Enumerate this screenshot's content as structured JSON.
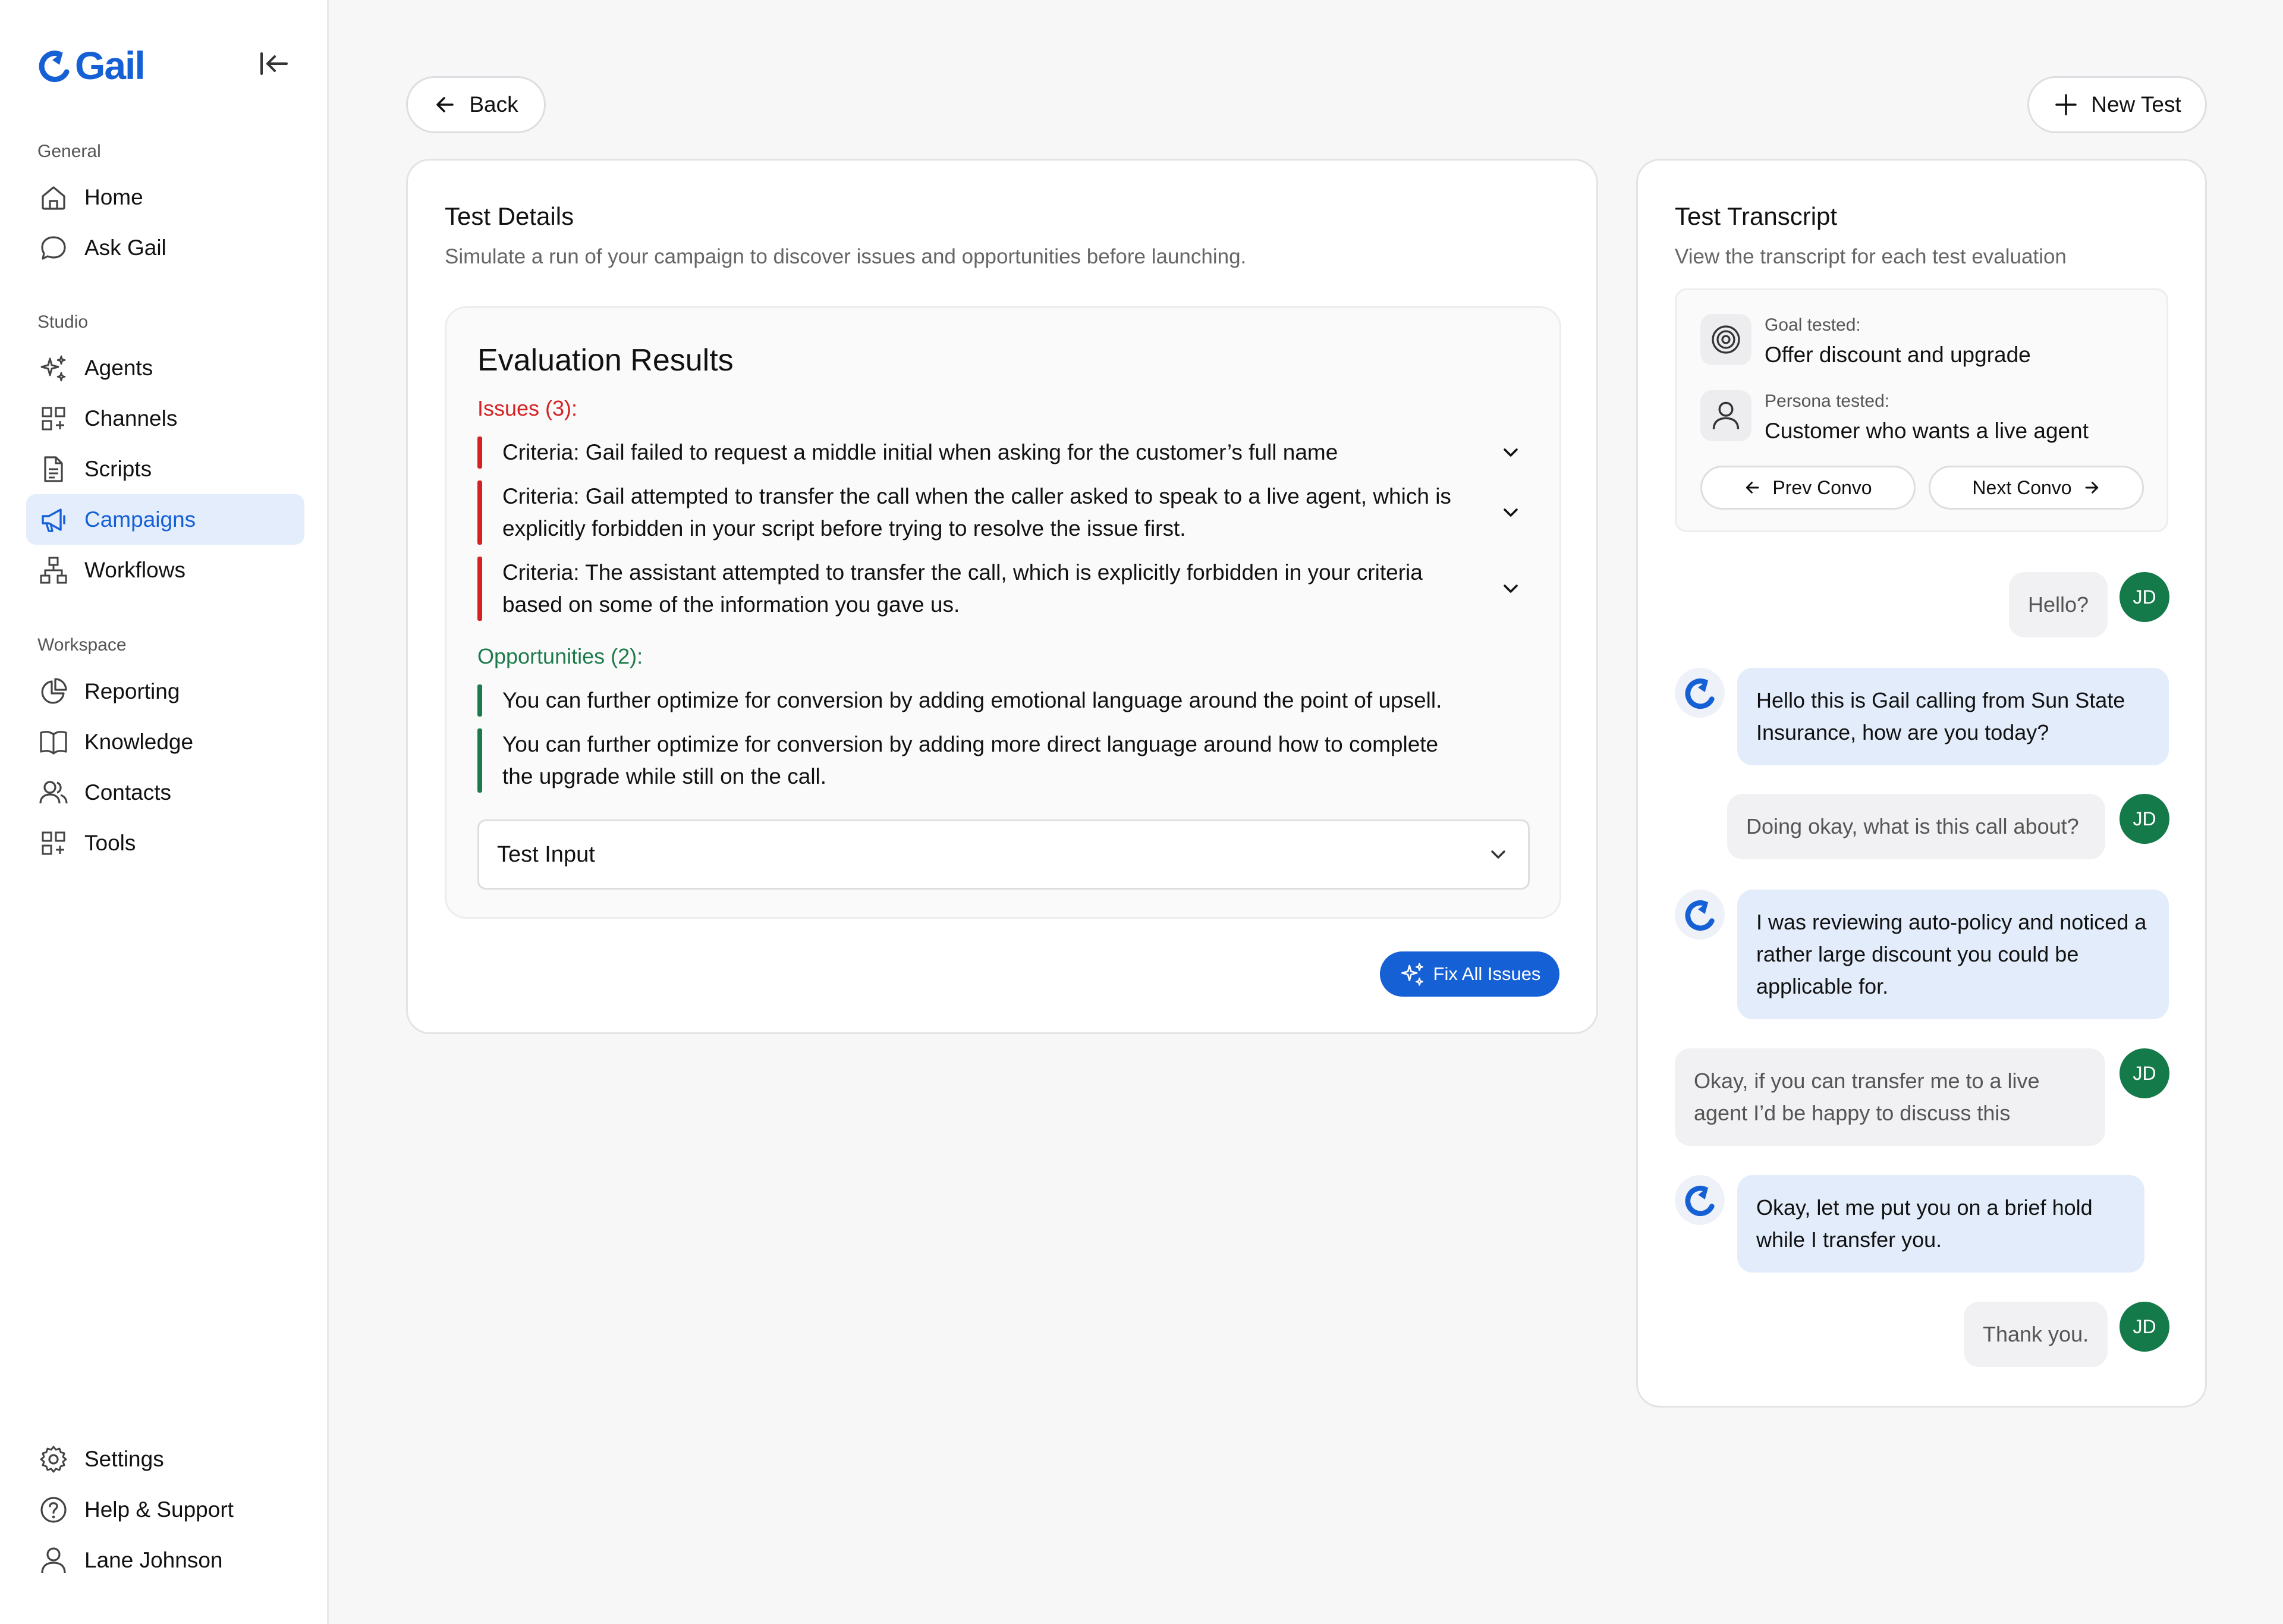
{
  "app": {
    "name": "Gail"
  },
  "colors": {
    "brand": "#1560d4",
    "issue": "#d42121",
    "opportunity": "#1d7a4a",
    "avatar": "#157a4a"
  },
  "sidebar": {
    "sections": [
      {
        "label": "General"
      },
      {
        "label": "Studio"
      },
      {
        "label": "Workspace"
      }
    ],
    "items": [
      {
        "label": "Home",
        "icon": "home-icon"
      },
      {
        "label": "Ask Gail",
        "icon": "chat-bubble-icon"
      },
      {
        "label": "Agents",
        "icon": "sparkle-icon"
      },
      {
        "label": "Channels",
        "icon": "grid-plus-icon"
      },
      {
        "label": "Scripts",
        "icon": "document-icon"
      },
      {
        "label": "Campaigns",
        "icon": "megaphone-icon",
        "active": true
      },
      {
        "label": "Workflows",
        "icon": "workflow-icon"
      },
      {
        "label": "Reporting",
        "icon": "pie-chart-icon"
      },
      {
        "label": "Knowledge",
        "icon": "book-icon"
      },
      {
        "label": "Contacts",
        "icon": "users-icon"
      },
      {
        "label": "Tools",
        "icon": "grid-plus-icon"
      }
    ],
    "footer": [
      {
        "label": "Settings",
        "icon": "gear-icon"
      },
      {
        "label": "Help & Support",
        "icon": "help-icon"
      },
      {
        "label": "Lane Johnson",
        "icon": "user-icon"
      }
    ]
  },
  "header": {
    "back_label": "Back",
    "new_test_label": "New Test"
  },
  "details": {
    "title": "Test Details",
    "subtitle": "Simulate a run of your campaign to discover issues and opportunities before launching.",
    "eval_title": "Evaluation Results",
    "issues_label": "Issues (3):",
    "issues": [
      "Criteria: Gail failed to request a middle initial when asking for the customer’s full name",
      "Criteria: Gail attempted to transfer the call when the caller asked to speak to a live agent, which is explicitly forbidden in your script before trying to resolve the issue first.",
      "Criteria: The assistant attempted to transfer the call, which is explicitly forbidden in your criteria based on some of the information you gave us."
    ],
    "opportunities_label": "Opportunities (2):",
    "opportunities": [
      "You can further optimize for conversion by adding emotional language around the point of upsell.",
      "You can further optimize for conversion by adding more direct language around how to complete the upgrade while still on the call."
    ],
    "test_input_label": "Test Input",
    "fix_all_label": "Fix All Issues"
  },
  "transcript": {
    "title": "Test Transcript",
    "subtitle": "View the transcript for each test evaluation",
    "goal_label": "Goal tested:",
    "goal_value": "Offer discount and upgrade",
    "persona_label": "Persona tested:",
    "persona_value": "Customer who wants a live agent",
    "prev_label": "Prev Convo",
    "next_label": "Next Convo",
    "user_initials": "JD",
    "messages": [
      {
        "from": "user",
        "text": "Hello?"
      },
      {
        "from": "bot",
        "text": "Hello this is Gail calling from Sun State Insurance, how are you today?"
      },
      {
        "from": "user",
        "text": "Doing okay, what is this call about?"
      },
      {
        "from": "bot",
        "text": "I was reviewing auto-policy and noticed a rather large discount you could be applicable for."
      },
      {
        "from": "user",
        "text": "Okay, if you can transfer me to a live agent I’d be happy to discuss this"
      },
      {
        "from": "bot",
        "text": "Okay, let me put you on a brief hold while I transfer you."
      },
      {
        "from": "user",
        "text": "Thank you."
      }
    ]
  }
}
